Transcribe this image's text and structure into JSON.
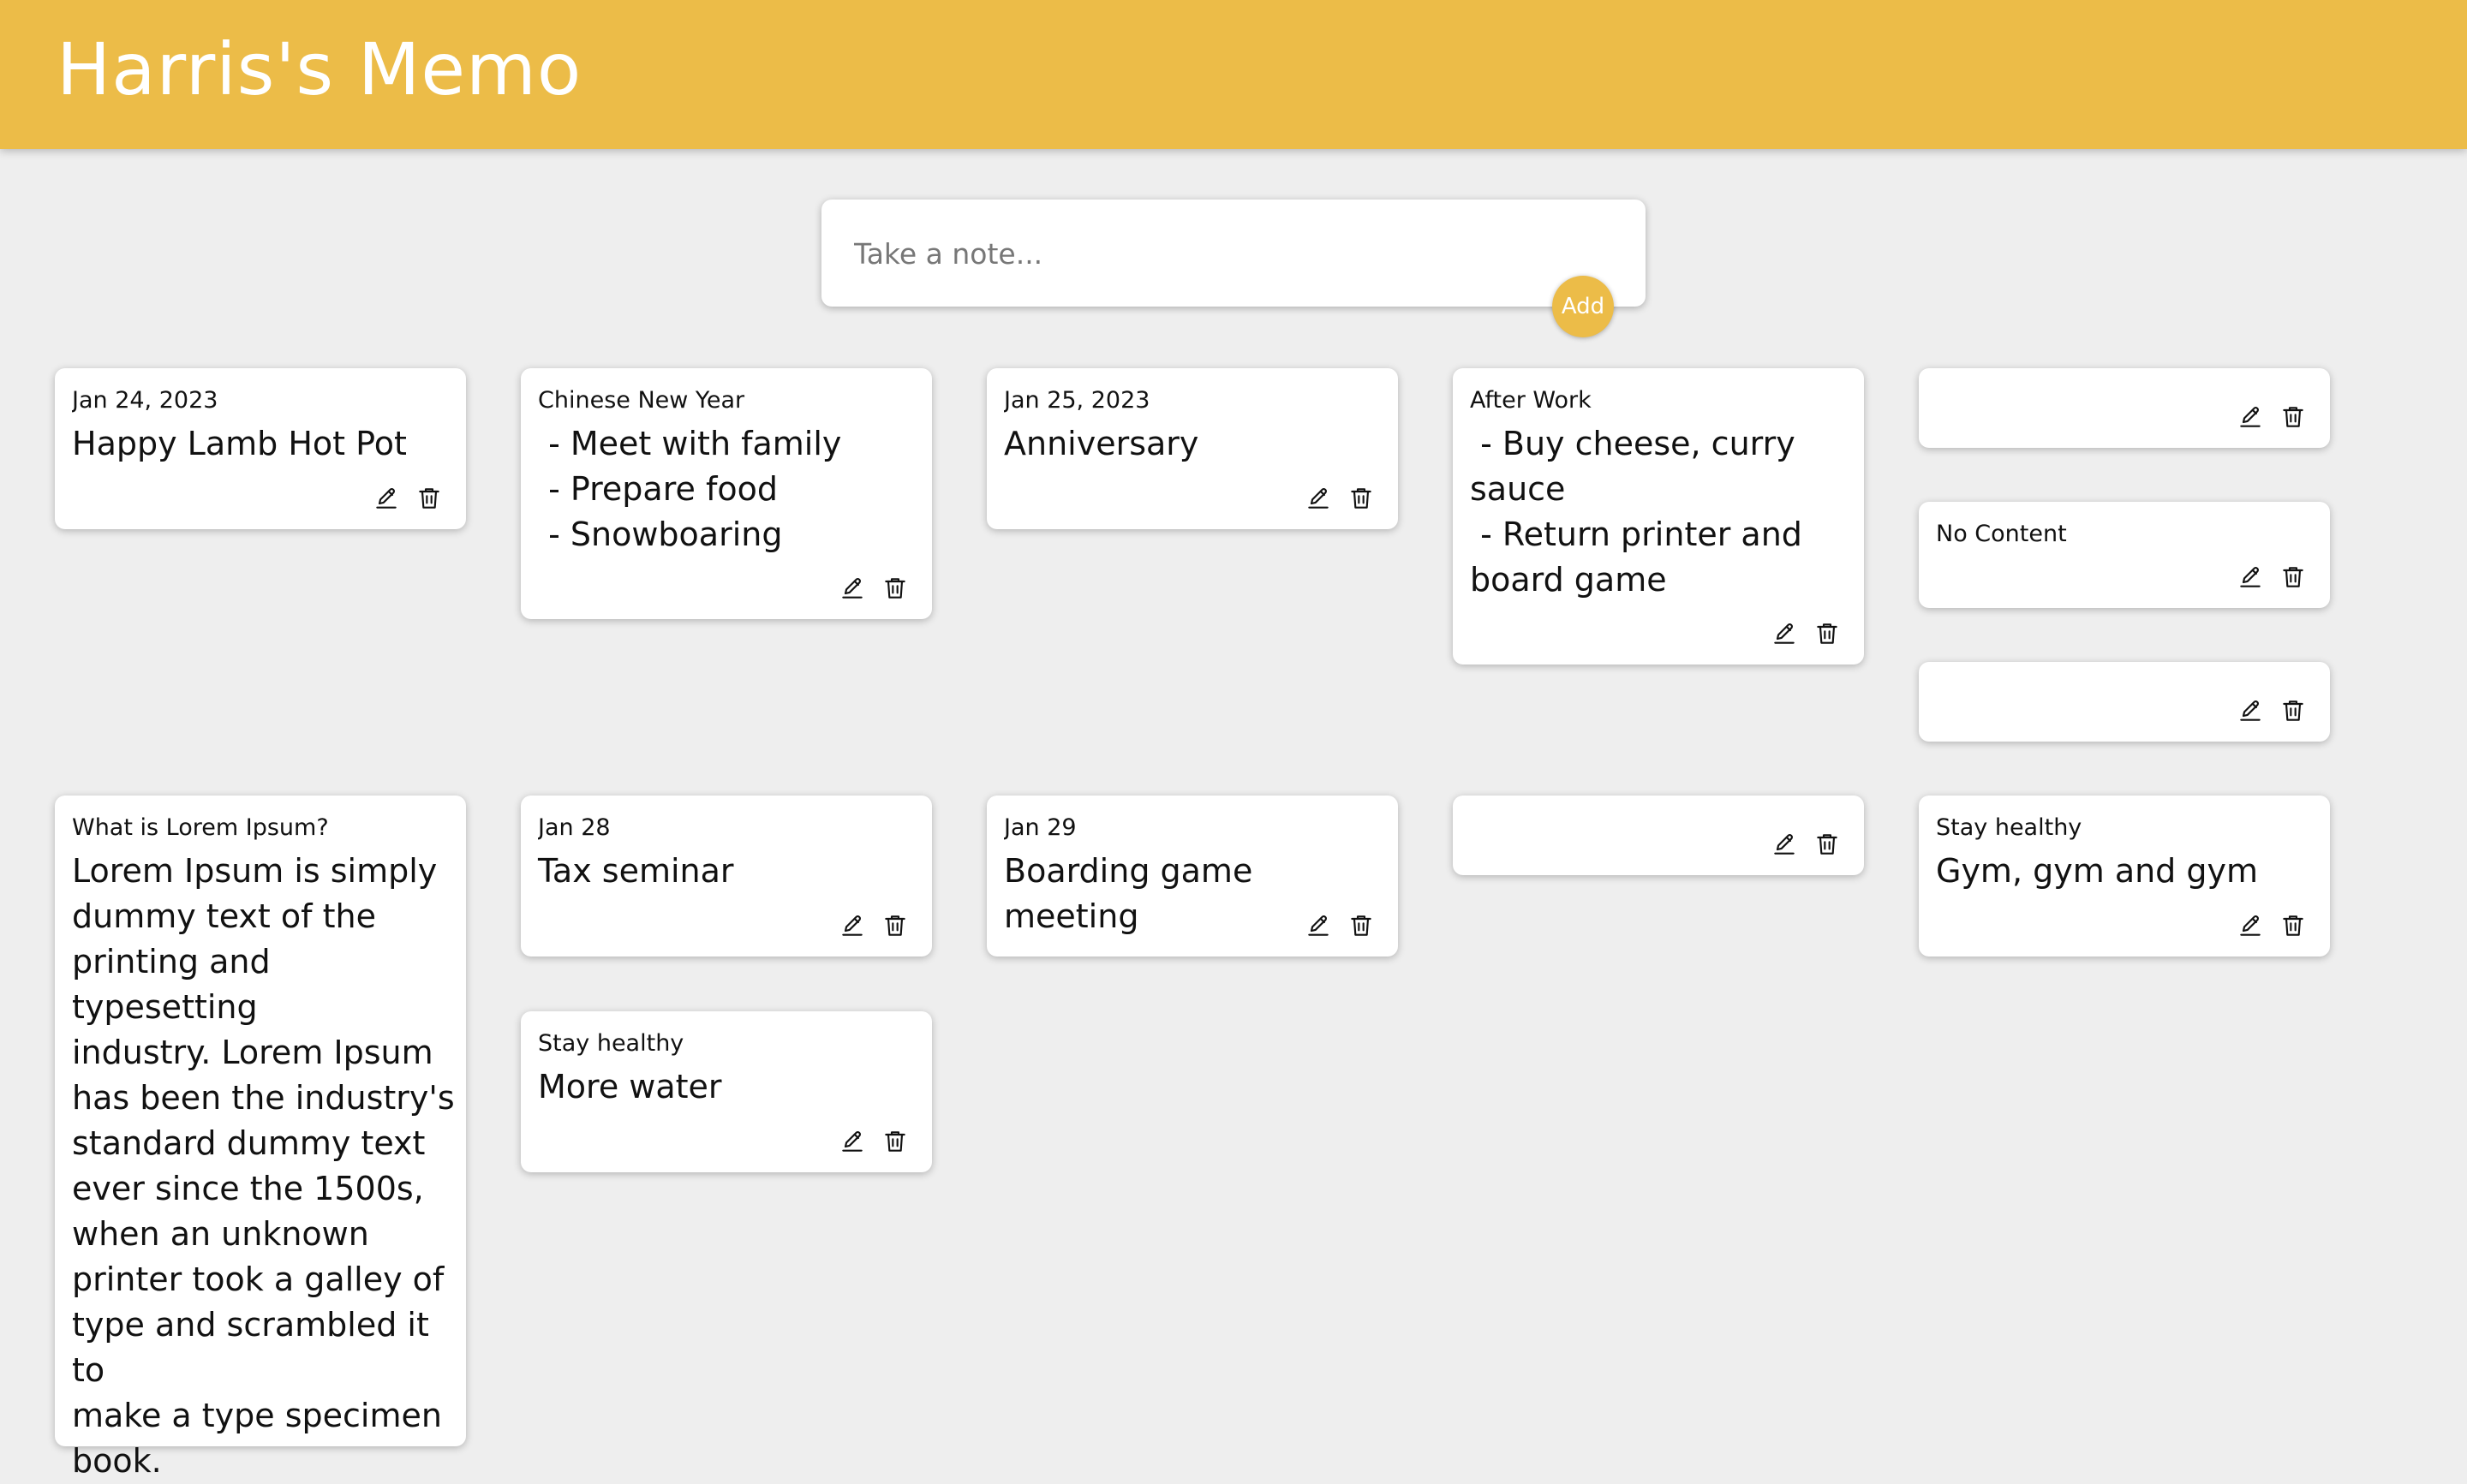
{
  "app": {
    "title": "Harris's Memo"
  },
  "composer": {
    "placeholder": "Take a note...",
    "add_label": "Add"
  },
  "icons": {
    "edit": "pencil-icon",
    "delete": "trash-icon"
  },
  "colors": {
    "brand": "#ecbc48",
    "background": "#eeeeee",
    "card": "#ffffff"
  },
  "notes": [
    {
      "title": "Jan 24, 2023",
      "content": "Happy Lamb Hot Pot"
    },
    {
      "title": "Chinese New Year",
      "content": " - Meet with family\n - Prepare food\n - Snowboaring"
    },
    {
      "title": "Jan 25, 2023",
      "content": "Anniversary"
    },
    {
      "title": "After Work",
      "content": " - Buy cheese, curry\nsauce\n - Return printer and\nboard game"
    },
    {
      "title": "",
      "content": ""
    },
    {
      "title": "No Content",
      "content": ""
    },
    {
      "title": "",
      "content": ""
    },
    {
      "title": "What is Lorem Ipsum?",
      "content": "Lorem Ipsum is simply\ndummy text of the\nprinting and typesetting\nindustry. Lorem Ipsum\nhas been the industry's\nstandard dummy text\never since the 1500s,\nwhen an unknown\nprinter took a galley of\ntype and scrambled it to\nmake a type specimen\nbook."
    },
    {
      "title": "Jan 28",
      "content": "Tax seminar"
    },
    {
      "title": "Stay healthy",
      "content": "More water"
    },
    {
      "title": "Jan 29",
      "content": "Boarding game meeting"
    },
    {
      "title": "",
      "content": ""
    },
    {
      "title": "Stay healthy",
      "content": "Gym, gym and gym"
    }
  ]
}
